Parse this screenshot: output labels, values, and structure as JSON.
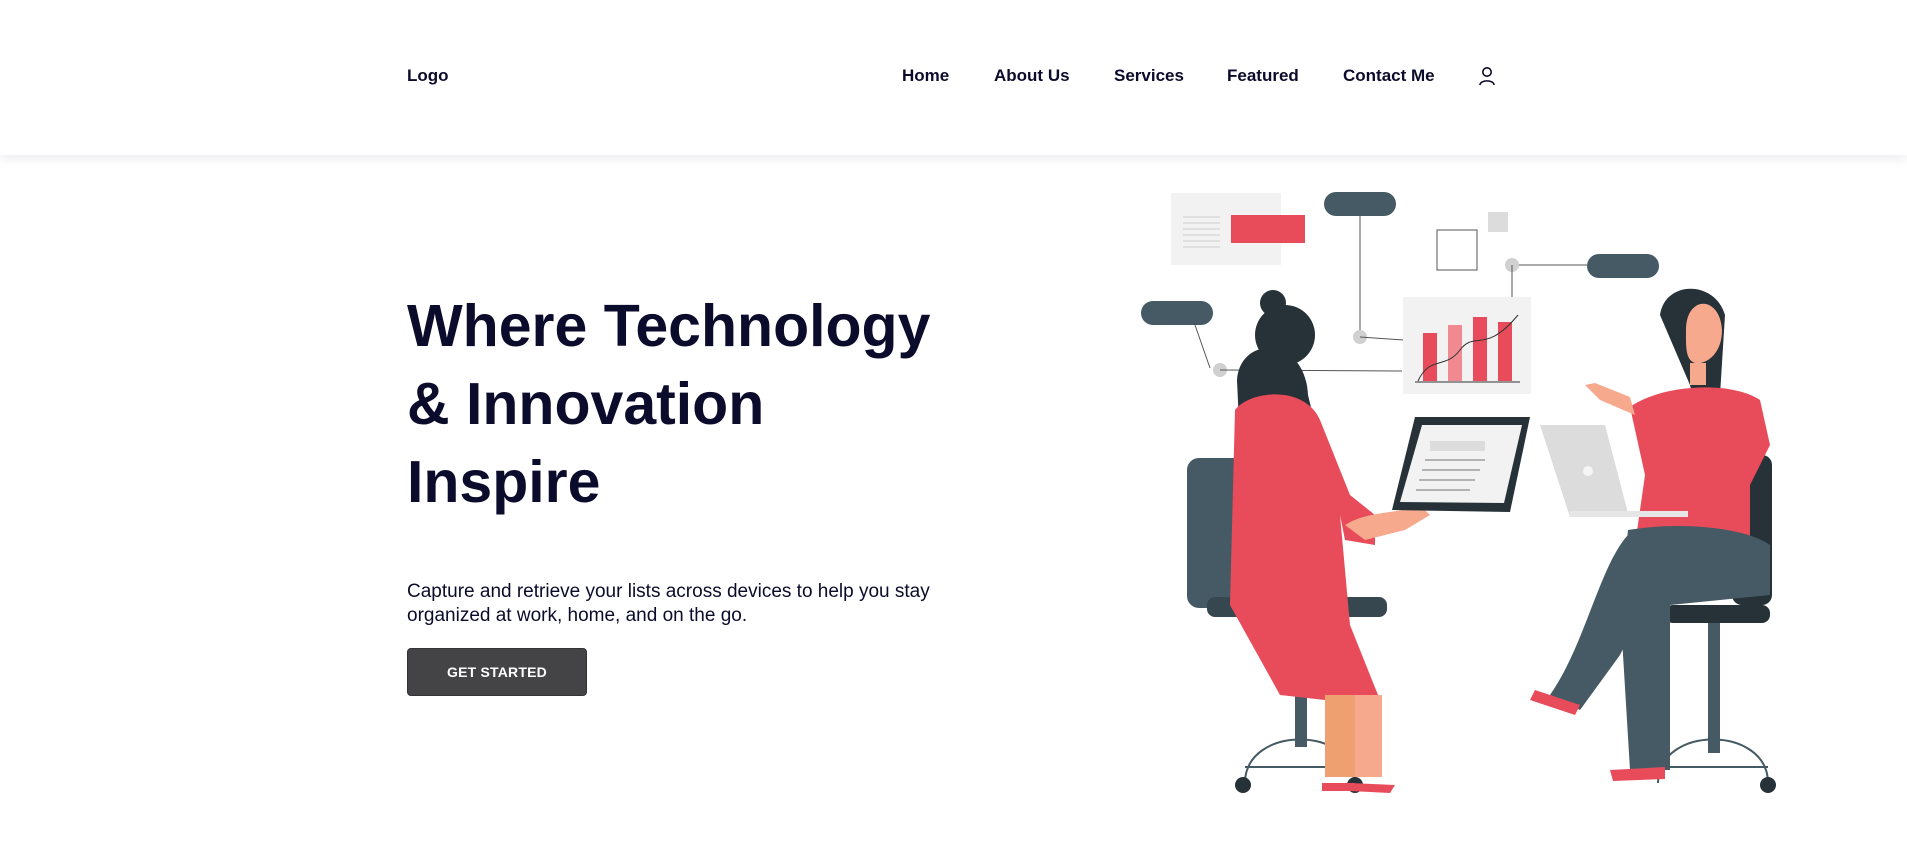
{
  "header": {
    "logo": "Logo",
    "nav": [
      {
        "label": "Home"
      },
      {
        "label": "About Us"
      },
      {
        "label": "Services"
      },
      {
        "label": "Featured"
      },
      {
        "label": "Contact Me"
      }
    ],
    "user_icon": "user-icon"
  },
  "hero": {
    "title_lines": [
      "Where Technology",
      "& Innovation",
      "Inspire"
    ],
    "subtitle": "Capture and retrieve your lists across devices to help you stay organized at work, home, and on the go.",
    "cta_label": "GET STARTED"
  },
  "illustration": {
    "description_icon": "two-women-working-illustration",
    "colors": {
      "accent": "#e84c5a",
      "dark": "#455a64",
      "skin": "#f6a98c",
      "light": "#f2f2f2"
    }
  }
}
